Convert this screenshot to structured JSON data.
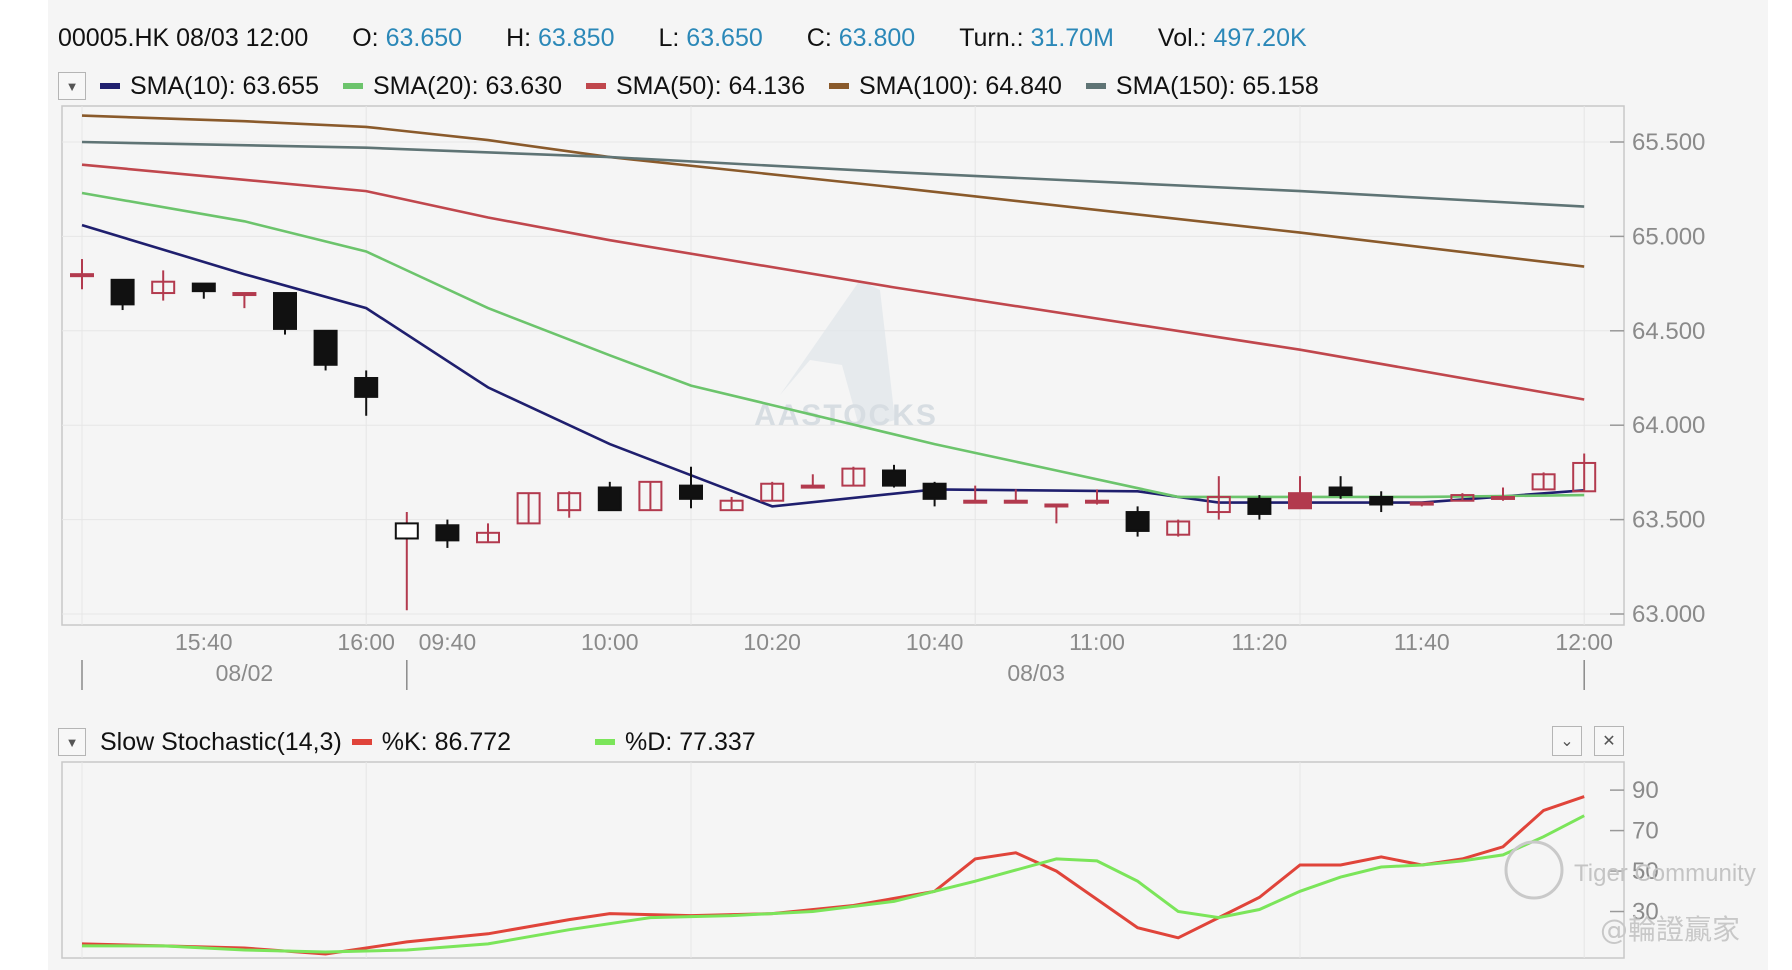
{
  "header": {
    "symbol": "00005.HK",
    "datetime": "08/03 12:00",
    "open_label": "O:",
    "open_value": "63.650",
    "high_label": "H:",
    "high_value": "63.850",
    "low_label": "L:",
    "low_value": "63.650",
    "close_label": "C:",
    "close_value": "63.800",
    "turnover_label": "Turn.:",
    "turnover_value": "31.70M",
    "volume_label": "Vol.:",
    "volume_value": "497.20K"
  },
  "legend": [
    {
      "label": "SMA(10): 63.655",
      "color": "#1f1f6e"
    },
    {
      "label": "SMA(20): 63.630",
      "color": "#6cc46c"
    },
    {
      "label": "SMA(50): 64.136",
      "color": "#c0474d"
    },
    {
      "label": "SMA(100): 64.840",
      "color": "#8a5a2b"
    },
    {
      "label": "SMA(150): 65.158",
      "color": "#5f7475"
    }
  ],
  "stochastic_header": {
    "title": "Slow Stochastic(14,3)",
    "k_label": "%K: 86.772",
    "k_color": "#e0443a",
    "d_label": "%D: 77.337",
    "d_color": "#7be55a"
  },
  "watermarks": {
    "center": "AASTOCKS",
    "corner_line1": "Tiger Community",
    "corner_line2": "@輪證贏家"
  },
  "chart_data": [
    {
      "type": "candlestick",
      "ylim": [
        63.0,
        65.5
      ],
      "yticks": [
        "65.500",
        "65.000",
        "64.500",
        "64.000",
        "63.500",
        "63.000"
      ],
      "xticks": [
        "15:40",
        "16:00",
        "09:40",
        "10:00",
        "10:20",
        "10:40",
        "11:00",
        "11:20",
        "11:40",
        "12:00"
      ],
      "date_labels": [
        "08/02",
        "08/03"
      ],
      "candles": [
        {
          "o": 64.8,
          "h": 64.88,
          "l": 64.72,
          "c": 64.8
        },
        {
          "o": 64.77,
          "h": 64.77,
          "l": 64.61,
          "c": 64.64
        },
        {
          "o": 64.7,
          "h": 64.82,
          "l": 64.66,
          "c": 64.76
        },
        {
          "o": 64.75,
          "h": 64.75,
          "l": 64.67,
          "c": 64.71
        },
        {
          "o": 64.7,
          "h": 64.7,
          "l": 64.62,
          "c": 64.7
        },
        {
          "o": 64.7,
          "h": 64.7,
          "l": 64.48,
          "c": 64.51
        },
        {
          "o": 64.5,
          "h": 64.5,
          "l": 64.29,
          "c": 64.32
        },
        {
          "o": 64.25,
          "h": 64.29,
          "l": 64.05,
          "c": 64.15
        },
        {
          "o": 63.4,
          "h": 63.54,
          "l": 63.02,
          "c": 63.48
        },
        {
          "o": 63.47,
          "h": 63.5,
          "l": 63.35,
          "c": 63.39
        },
        {
          "o": 63.38,
          "h": 63.48,
          "l": 63.38,
          "c": 63.43
        },
        {
          "o": 63.48,
          "h": 63.64,
          "l": 63.48,
          "c": 63.64
        },
        {
          "o": 63.55,
          "h": 63.65,
          "l": 63.51,
          "c": 63.64
        },
        {
          "o": 63.67,
          "h": 63.7,
          "l": 63.55,
          "c": 63.55
        },
        {
          "o": 63.55,
          "h": 63.7,
          "l": 63.55,
          "c": 63.7
        },
        {
          "o": 63.68,
          "h": 63.78,
          "l": 63.56,
          "c": 63.61
        },
        {
          "o": 63.55,
          "h": 63.62,
          "l": 63.55,
          "c": 63.6
        },
        {
          "o": 63.6,
          "h": 63.7,
          "l": 63.6,
          "c": 63.69
        },
        {
          "o": 63.68,
          "h": 63.74,
          "l": 63.68,
          "c": 63.68
        },
        {
          "o": 63.68,
          "h": 63.78,
          "l": 63.68,
          "c": 63.77
        },
        {
          "o": 63.76,
          "h": 63.79,
          "l": 63.67,
          "c": 63.68
        },
        {
          "o": 63.69,
          "h": 63.7,
          "l": 63.57,
          "c": 63.61
        },
        {
          "o": 63.6,
          "h": 63.68,
          "l": 63.6,
          "c": 63.6
        },
        {
          "o": 63.6,
          "h": 63.66,
          "l": 63.6,
          "c": 63.6
        },
        {
          "o": 63.58,
          "h": 63.58,
          "l": 63.48,
          "c": 63.58
        },
        {
          "o": 63.6,
          "h": 63.66,
          "l": 63.58,
          "c": 63.6
        },
        {
          "o": 63.54,
          "h": 63.57,
          "l": 63.41,
          "c": 63.44
        },
        {
          "o": 63.42,
          "h": 63.5,
          "l": 63.41,
          "c": 63.49
        },
        {
          "o": 63.54,
          "h": 63.73,
          "l": 63.5,
          "c": 63.62
        },
        {
          "o": 63.61,
          "h": 63.63,
          "l": 63.5,
          "c": 63.53
        },
        {
          "o": 63.56,
          "h": 63.73,
          "l": 63.56,
          "c": 63.64
        },
        {
          "o": 63.67,
          "h": 63.73,
          "l": 63.61,
          "c": 63.63
        },
        {
          "o": 63.62,
          "h": 63.65,
          "l": 63.54,
          "c": 63.58
        },
        {
          "o": 63.59,
          "h": 63.59,
          "l": 63.57,
          "c": 63.59
        },
        {
          "o": 63.6,
          "h": 63.64,
          "l": 63.6,
          "c": 63.63
        },
        {
          "o": 63.62,
          "h": 63.67,
          "l": 63.6,
          "c": 63.62
        },
        {
          "o": 63.66,
          "h": 63.75,
          "l": 63.66,
          "c": 63.74
        },
        {
          "o": 63.65,
          "h": 63.85,
          "l": 63.65,
          "c": 63.8
        }
      ],
      "series": [
        {
          "name": "SMA(10)",
          "values": [
            [
              0,
              65.06
            ],
            [
              4,
              64.8
            ],
            [
              7,
              64.62
            ],
            [
              10,
              64.2
            ],
            [
              13,
              63.9
            ],
            [
              17,
              63.57
            ],
            [
              21,
              63.66
            ],
            [
              26,
              63.65
            ],
            [
              28,
              63.59
            ],
            [
              33,
              63.59
            ],
            [
              37,
              63.655
            ]
          ]
        },
        {
          "name": "SMA(20)",
          "values": [
            [
              0,
              65.23
            ],
            [
              4,
              65.08
            ],
            [
              7,
              64.92
            ],
            [
              10,
              64.62
            ],
            [
              13,
              64.37
            ],
            [
              15,
              64.21
            ],
            [
              21,
              63.9
            ],
            [
              24,
              63.76
            ],
            [
              27,
              63.62
            ],
            [
              33,
              63.62
            ],
            [
              37,
              63.63
            ]
          ]
        },
        {
          "name": "SMA(50)",
          "values": [
            [
              0,
              65.38
            ],
            [
              4,
              65.3
            ],
            [
              7,
              65.24
            ],
            [
              10,
              65.1
            ],
            [
              13,
              64.98
            ],
            [
              20,
              64.73
            ],
            [
              30,
              64.4
            ],
            [
              37,
              64.136
            ]
          ]
        },
        {
          "name": "SMA(100)",
          "values": [
            [
              0,
              65.64
            ],
            [
              4,
              65.61
            ],
            [
              7,
              65.58
            ],
            [
              10,
              65.51
            ],
            [
              13,
              65.42
            ],
            [
              20,
              65.26
            ],
            [
              30,
              65.02
            ],
            [
              37,
              64.84
            ]
          ]
        },
        {
          "name": "SMA(150)",
          "values": [
            [
              0,
              65.5
            ],
            [
              7,
              65.47
            ],
            [
              13,
              65.42
            ],
            [
              20,
              65.34
            ],
            [
              30,
              65.24
            ],
            [
              37,
              65.158
            ]
          ]
        }
      ]
    },
    {
      "type": "line",
      "title": "Slow Stochastic(14,3)",
      "ylim": [
        10,
        95
      ],
      "yticks": [
        "90",
        "70",
        "50",
        "30"
      ],
      "series": [
        {
          "name": "%K",
          "values": [
            [
              0,
              14
            ],
            [
              2,
              13
            ],
            [
              4,
              12
            ],
            [
              6,
              9
            ],
            [
              8,
              15
            ],
            [
              10,
              19
            ],
            [
              12,
              26
            ],
            [
              13,
              29
            ],
            [
              15,
              28
            ],
            [
              17,
              29
            ],
            [
              19,
              33
            ],
            [
              21,
              40
            ],
            [
              22,
              56
            ],
            [
              23,
              59
            ],
            [
              24,
              50
            ],
            [
              25,
              36
            ],
            [
              26,
              22
            ],
            [
              27,
              17
            ],
            [
              28,
              27
            ],
            [
              29,
              37
            ],
            [
              30,
              53
            ],
            [
              31,
              53
            ],
            [
              32,
              57
            ],
            [
              33,
              53
            ],
            [
              34,
              56
            ],
            [
              35,
              62
            ],
            [
              36,
              80
            ],
            [
              37,
              86.772
            ]
          ]
        },
        {
          "name": "%D",
          "values": [
            [
              0,
              13
            ],
            [
              2,
              13
            ],
            [
              4,
              11
            ],
            [
              6,
              10
            ],
            [
              8,
              11
            ],
            [
              10,
              14
            ],
            [
              12,
              21
            ],
            [
              14,
              27
            ],
            [
              16,
              28
            ],
            [
              18,
              30
            ],
            [
              20,
              35
            ],
            [
              22,
              45
            ],
            [
              24,
              56
            ],
            [
              25,
              55
            ],
            [
              26,
              45
            ],
            [
              27,
              30
            ],
            [
              28,
              27
            ],
            [
              29,
              31
            ],
            [
              30,
              40
            ],
            [
              31,
              47
            ],
            [
              32,
              52
            ],
            [
              33,
              53
            ],
            [
              34,
              55
            ],
            [
              35,
              58
            ],
            [
              36,
              67
            ],
            [
              37,
              77.337
            ]
          ]
        }
      ]
    }
  ]
}
